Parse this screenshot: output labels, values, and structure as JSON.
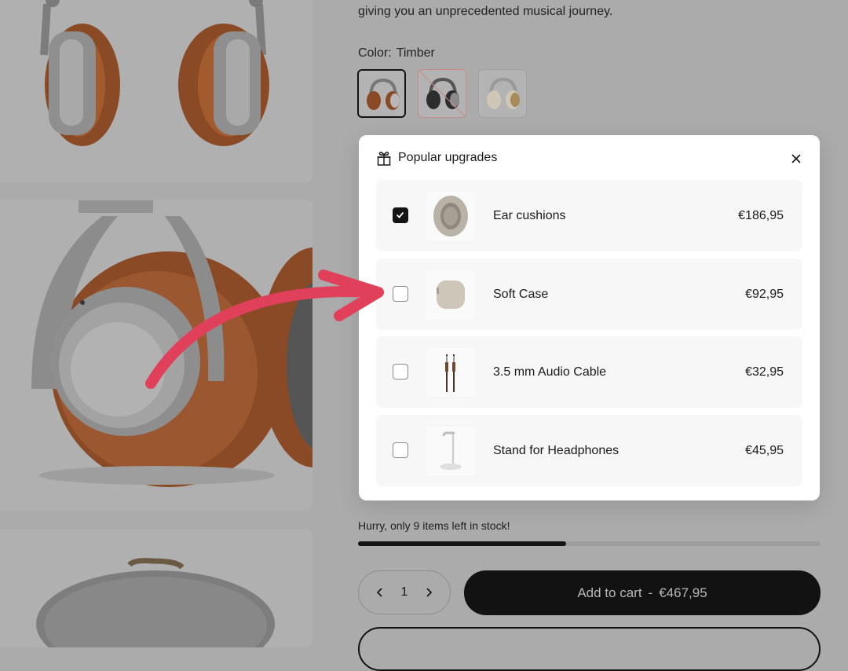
{
  "product": {
    "description": "giving you an unprecedented musical journey.",
    "color_label": "Color:",
    "color_value": "Timber"
  },
  "swatches": [
    {
      "name": "Timber",
      "state": "selected"
    },
    {
      "name": "Black",
      "state": "unavailable"
    },
    {
      "name": "Cream",
      "state": "available"
    }
  ],
  "upgrades": {
    "title": "Popular upgrades",
    "items": [
      {
        "name": "Ear cushions",
        "price": "€186,95",
        "checked": true
      },
      {
        "name": "Soft Case",
        "price": "€92,95",
        "checked": false
      },
      {
        "name": "3.5 mm Audio Cable",
        "price": "€32,95",
        "checked": false
      },
      {
        "name": "Stand for Headphones",
        "price": "€45,95",
        "checked": false
      }
    ]
  },
  "stock": {
    "text": "Hurry, only 9 items left in stock!",
    "level": 0.45
  },
  "cart": {
    "quantity": "1",
    "label": "Add to cart",
    "separator": "-",
    "total": "€467,95"
  },
  "colors": {
    "accent": "#e0405a",
    "button_bg": "#121212"
  }
}
